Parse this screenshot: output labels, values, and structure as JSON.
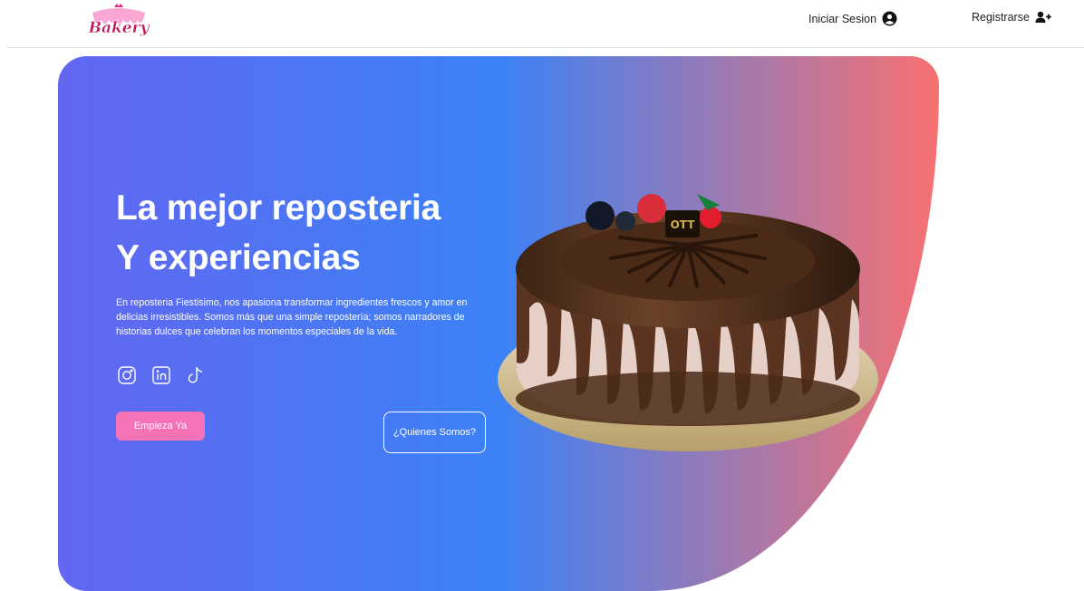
{
  "nav": {
    "logo_text": "Bakery",
    "login_label": "Iniciar Sesion",
    "login_icon": "user-circle-icon",
    "register_label": "Registrarse",
    "register_icon": "user-plus-icon"
  },
  "hero": {
    "title_line1": "La mejor reposteria",
    "title_line2": "Y experiencias",
    "description": "En reposteria Fiestisimo, nos apasiona transformar ingredientes frescos y amor en delicias irresistibles. Somos más que una simple repostería; somos narradores de historias dulces que celebran los momentos especiales de la vida.",
    "socials": [
      "instagram-icon",
      "linkedin-icon",
      "tiktok-icon"
    ],
    "primary_button": "Empieza Ya",
    "secondary_button": "¿Quienes Somos?",
    "cake_plaque_text": "OTT",
    "colors": {
      "gradient_start": "#6366f1",
      "gradient_mid": "#3b82f6",
      "gradient_end": "#f87171",
      "button_pink": "#f472b6"
    }
  }
}
